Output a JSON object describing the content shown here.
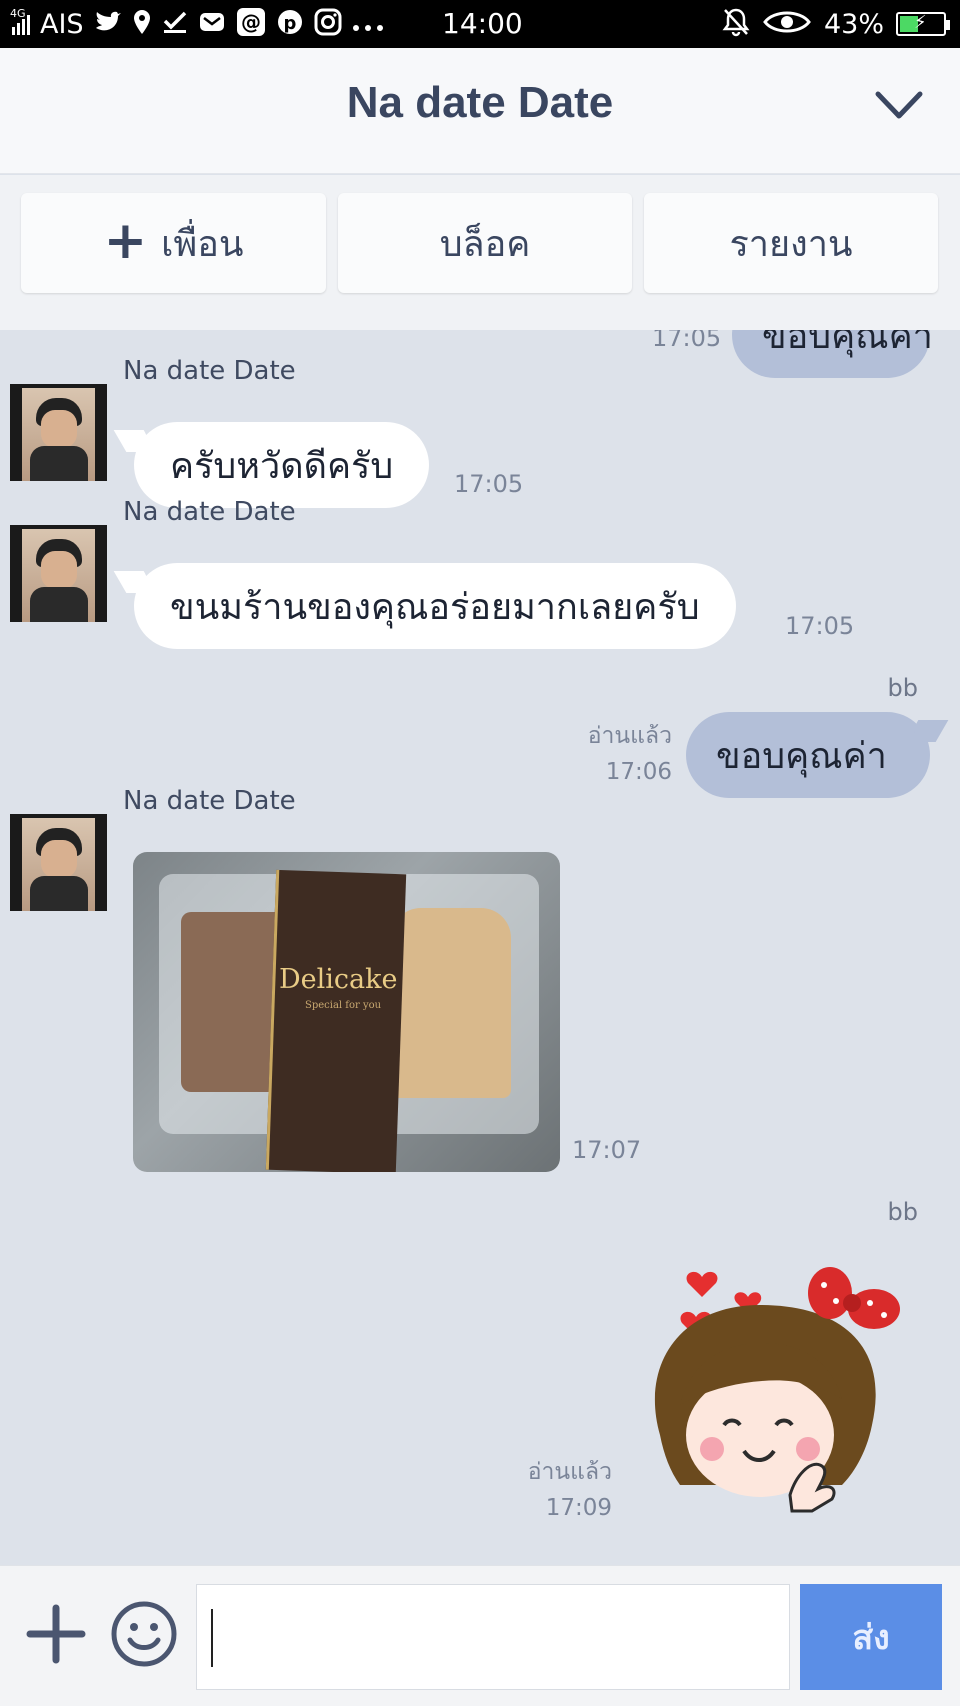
{
  "status_bar": {
    "carrier": "AIS",
    "network": "4G",
    "time": "14:00",
    "battery": "43%",
    "battery_level": 0.43,
    "icons": [
      "signal-icon",
      "twitter-icon",
      "location-icon",
      "task-icon",
      "mail-icon",
      "at-icon",
      "pinterest-icon",
      "instagram-icon",
      "more-icon",
      "bell-off-icon",
      "eye-icon",
      "battery-icon"
    ]
  },
  "header": {
    "title": "Na date Date",
    "collapse_icon": "chevron-down-icon"
  },
  "actions": {
    "add_friend": "เพื่อน",
    "block": "บล็อค",
    "report": "รายงาน"
  },
  "chat": {
    "partial_top": {
      "text": "ขอบคุณค่า",
      "time": "17:05"
    },
    "messages": [
      {
        "sender": "Na date Date",
        "text": "ครับหวัดดีครับ",
        "time": "17:05"
      },
      {
        "sender": "Na date Date",
        "text": "ขนมร้านของคุณอร่อยมากเลยครับ",
        "time": "17:05"
      },
      {
        "sender": "bb",
        "text": "ขอบคุณค่า",
        "read": "อ่านแล้ว",
        "time": "17:06"
      },
      {
        "sender": "Na date Date",
        "image_brand": "Delicake",
        "image_tagline": "Special for you",
        "time": "17:07"
      },
      {
        "sender": "bb",
        "sticker": "girl-hearts-sticker",
        "read": "อ่านแล้ว",
        "time": "17:09"
      }
    ]
  },
  "input_bar": {
    "placeholder": "",
    "send_label": "ส่ง"
  },
  "colors": {
    "chat_bg": "#dde2ea",
    "outgoing_bubble": "#b3bfd8",
    "send_button": "#5b8ee6"
  }
}
